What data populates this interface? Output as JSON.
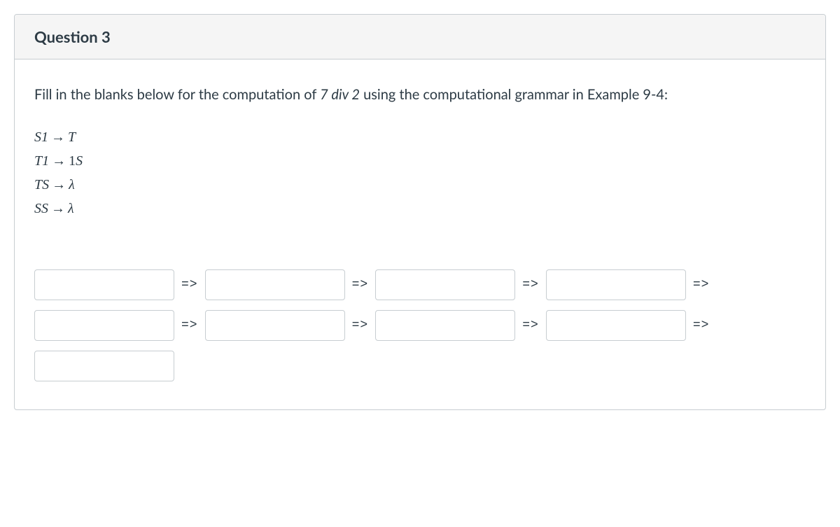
{
  "header": {
    "title": "Question 3"
  },
  "prompt": {
    "part1": "Fill in the blanks below for the computation of ",
    "italic": "7 div 2",
    "part2": " using the computational grammar in Example 9-4:"
  },
  "grammar": {
    "rules": [
      {
        "lhs": "S1",
        "rhs": "T"
      },
      {
        "lhs": "T1",
        "rhs": "1S"
      },
      {
        "lhs": "TS",
        "rhs": "λ"
      },
      {
        "lhs": "SS",
        "rhs": "λ"
      }
    ]
  },
  "derives_symbol": "=>",
  "blanks": {
    "count": 9,
    "derives_after": [
      true,
      true,
      true,
      true,
      true,
      true,
      true,
      true,
      false
    ]
  }
}
